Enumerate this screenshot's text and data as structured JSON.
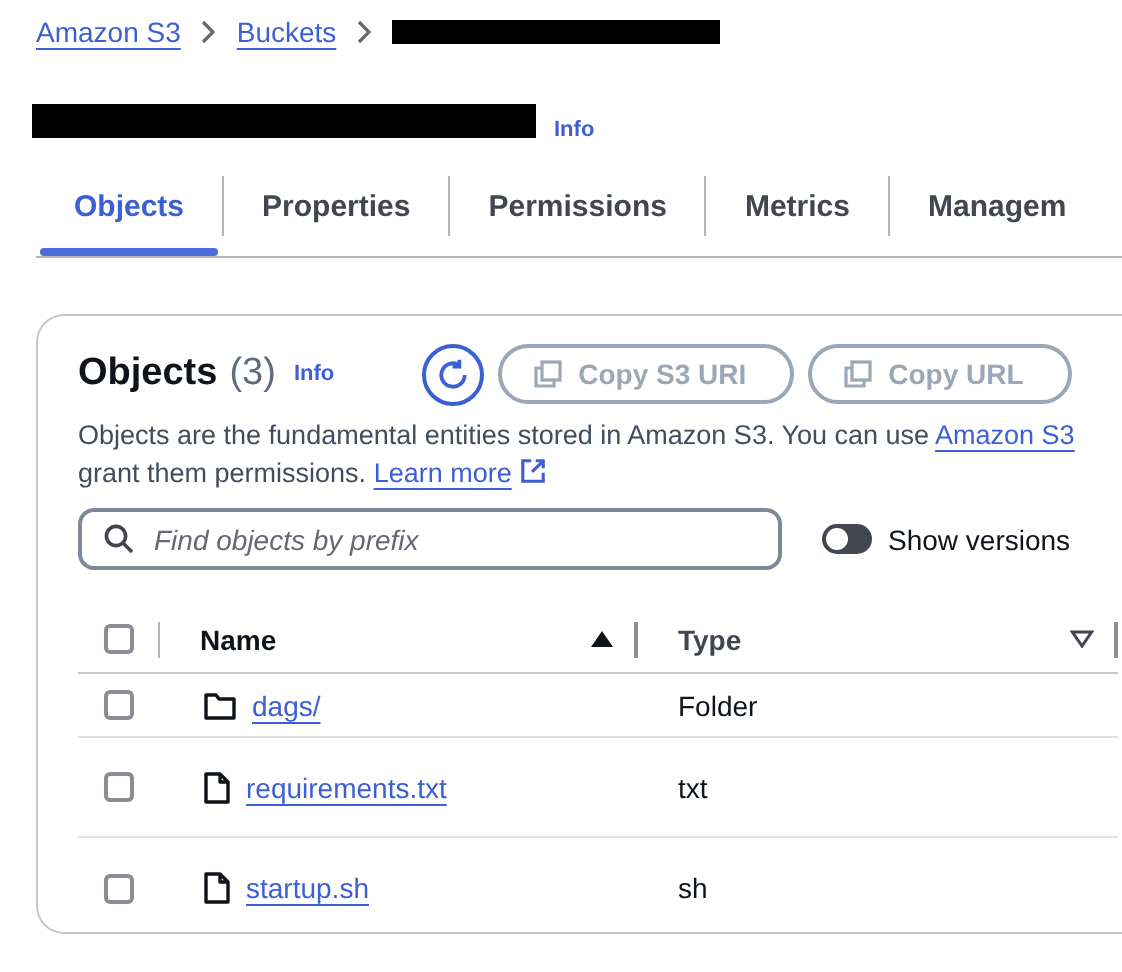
{
  "breadcrumbs": [
    {
      "kind": "link",
      "label": "Amazon S3"
    },
    {
      "kind": "link",
      "label": "Buckets"
    },
    {
      "kind": "redacted"
    }
  ],
  "page_title": {
    "redacted": true,
    "info": "Info"
  },
  "tabs": [
    {
      "label": "Objects",
      "selected": true
    },
    {
      "label": "Properties",
      "selected": false
    },
    {
      "label": "Permissions",
      "selected": false
    },
    {
      "label": "Metrics",
      "selected": false
    },
    {
      "label": "Managem",
      "selected": false
    }
  ],
  "objects_panel": {
    "title": "Objects",
    "count": "(3)",
    "info": "Info",
    "actions": [
      {
        "kind": "refresh",
        "disabled": false
      },
      {
        "kind": "copy",
        "label": "Copy S3 URI",
        "disabled": true
      },
      {
        "kind": "copy",
        "label": "Copy URL",
        "disabled": true
      }
    ],
    "description": {
      "text_1": "Objects are the fundamental entities stored in Amazon S3. You can use ",
      "link_1": "Amazon S3",
      "text_2": "grant them permissions. ",
      "link_2": "Learn more"
    },
    "search": {
      "placeholder": "Find objects by prefix"
    },
    "show_versions": {
      "label": "Show versions",
      "on": false
    },
    "table": {
      "select_all": {
        "checked": false
      },
      "columns": [
        {
          "label": "Name",
          "sorted": true
        },
        {
          "label": "Type",
          "sorted": false
        }
      ],
      "rows": [
        {
          "name": "dags/",
          "kind": "folder",
          "type": "Folder",
          "selected": false
        },
        {
          "name": "requirements.txt",
          "kind": "file",
          "type": "txt",
          "selected": false
        },
        {
          "name": "startup.sh",
          "kind": "file",
          "type": "sh",
          "selected": false
        }
      ]
    }
  }
}
